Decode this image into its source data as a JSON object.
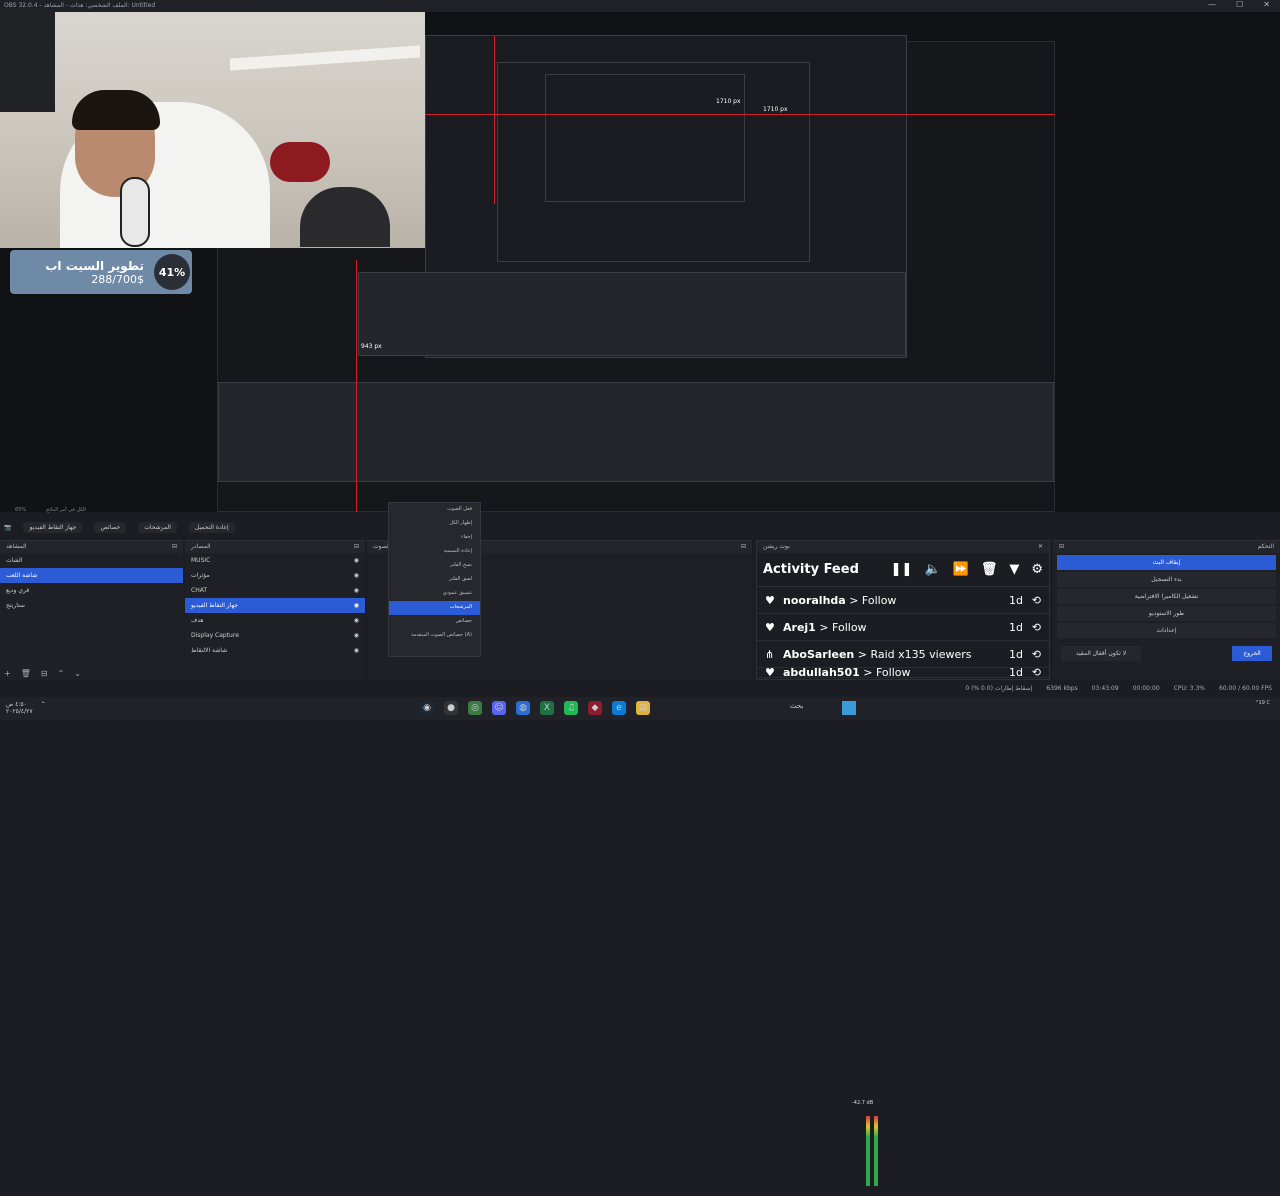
{
  "window": {
    "title": "OBS 32.0.4 - الملف الشخصي: هذات - المشاهد: Untitled",
    "controls": [
      "—",
      "☐",
      "✕"
    ]
  },
  "overlay": {
    "goal_title": "تطوير السيت اب",
    "goal_amount": "288/700$",
    "goal_percent": "41%",
    "dim_top": "1710 px",
    "dim_mid": "1710 px",
    "dim_bottom": "943 px"
  },
  "toolbar": {
    "zoom": "65%",
    "preview_label": "الكل في أمر النتائج"
  },
  "scene_bar": {
    "items": [
      "جهاز التقاط الفيديو",
      "خصائص",
      "المرشحات",
      "إعادة التحميل"
    ]
  },
  "scenes": {
    "title": "المشاهد",
    "items": [
      "الشات",
      "شاشة اللعب",
      "فري وديع",
      "ستاريتج"
    ],
    "selected_index": 1
  },
  "sources": {
    "title": "المصادر",
    "items": [
      {
        "label": "MUSIC"
      },
      {
        "label": "مؤثرات"
      },
      {
        "label": "CHAT"
      },
      {
        "label": "جهاز التقاط الفيديو"
      },
      {
        "label": "هدف"
      },
      {
        "label": "Display Capture"
      },
      {
        "label": "شاشة الالتقاط"
      }
    ],
    "selected_index": 3
  },
  "context_menu": {
    "title": "قفل الصوت",
    "items": [
      "إظهار الكل",
      "إخفاء",
      "إعادة التسمية",
      "نسخ الفلتر",
      "لصق الفلتر",
      "تنسيق عمودي",
      "المرشحات",
      "خصائص",
      "خصائص الصوت المتقدمة (A)"
    ],
    "highlighted_index": 6
  },
  "mixer": {
    "title": "خلاط الصوت",
    "db": "-42.7 dB"
  },
  "activity_feed": {
    "panel_title": "بوت ريشن",
    "title": "Activity Feed",
    "items": [
      {
        "user": "nooralhda",
        "action": "> Follow",
        "age": "1d"
      },
      {
        "user": "Arej1",
        "action": "> Follow",
        "age": "1d"
      },
      {
        "user": "AboSarleen",
        "action": "> Raid x135 viewers",
        "age": "1d"
      },
      {
        "user": "abdullah501",
        "action": "> Follow",
        "age": "1d"
      }
    ]
  },
  "controls": {
    "title": "التحكم",
    "buttons": [
      "إيقاف البث",
      "بدء التسجيل",
      "تشغيل الكاميرا الافتراضية",
      "طور الاستوديو",
      "إعدادات"
    ],
    "bottom_left": "لا تكون أقفال المقيد",
    "bottom_right": "الخروج"
  },
  "status": {
    "dropped": "إسقاط إطارات (0.0 %) 0",
    "bitrate": "6396 kbps",
    "time": "03:43:09",
    "rec_time": "00:00:00",
    "cpu": "CPU: 3.3%",
    "fps": "60.00 / 60.00 FPS"
  },
  "taskbar": {
    "search": "بحث",
    "weather": "°19 C",
    "time": "٤:٥٠ ص",
    "date": "٢٠٢٥/٤/٢٧"
  }
}
